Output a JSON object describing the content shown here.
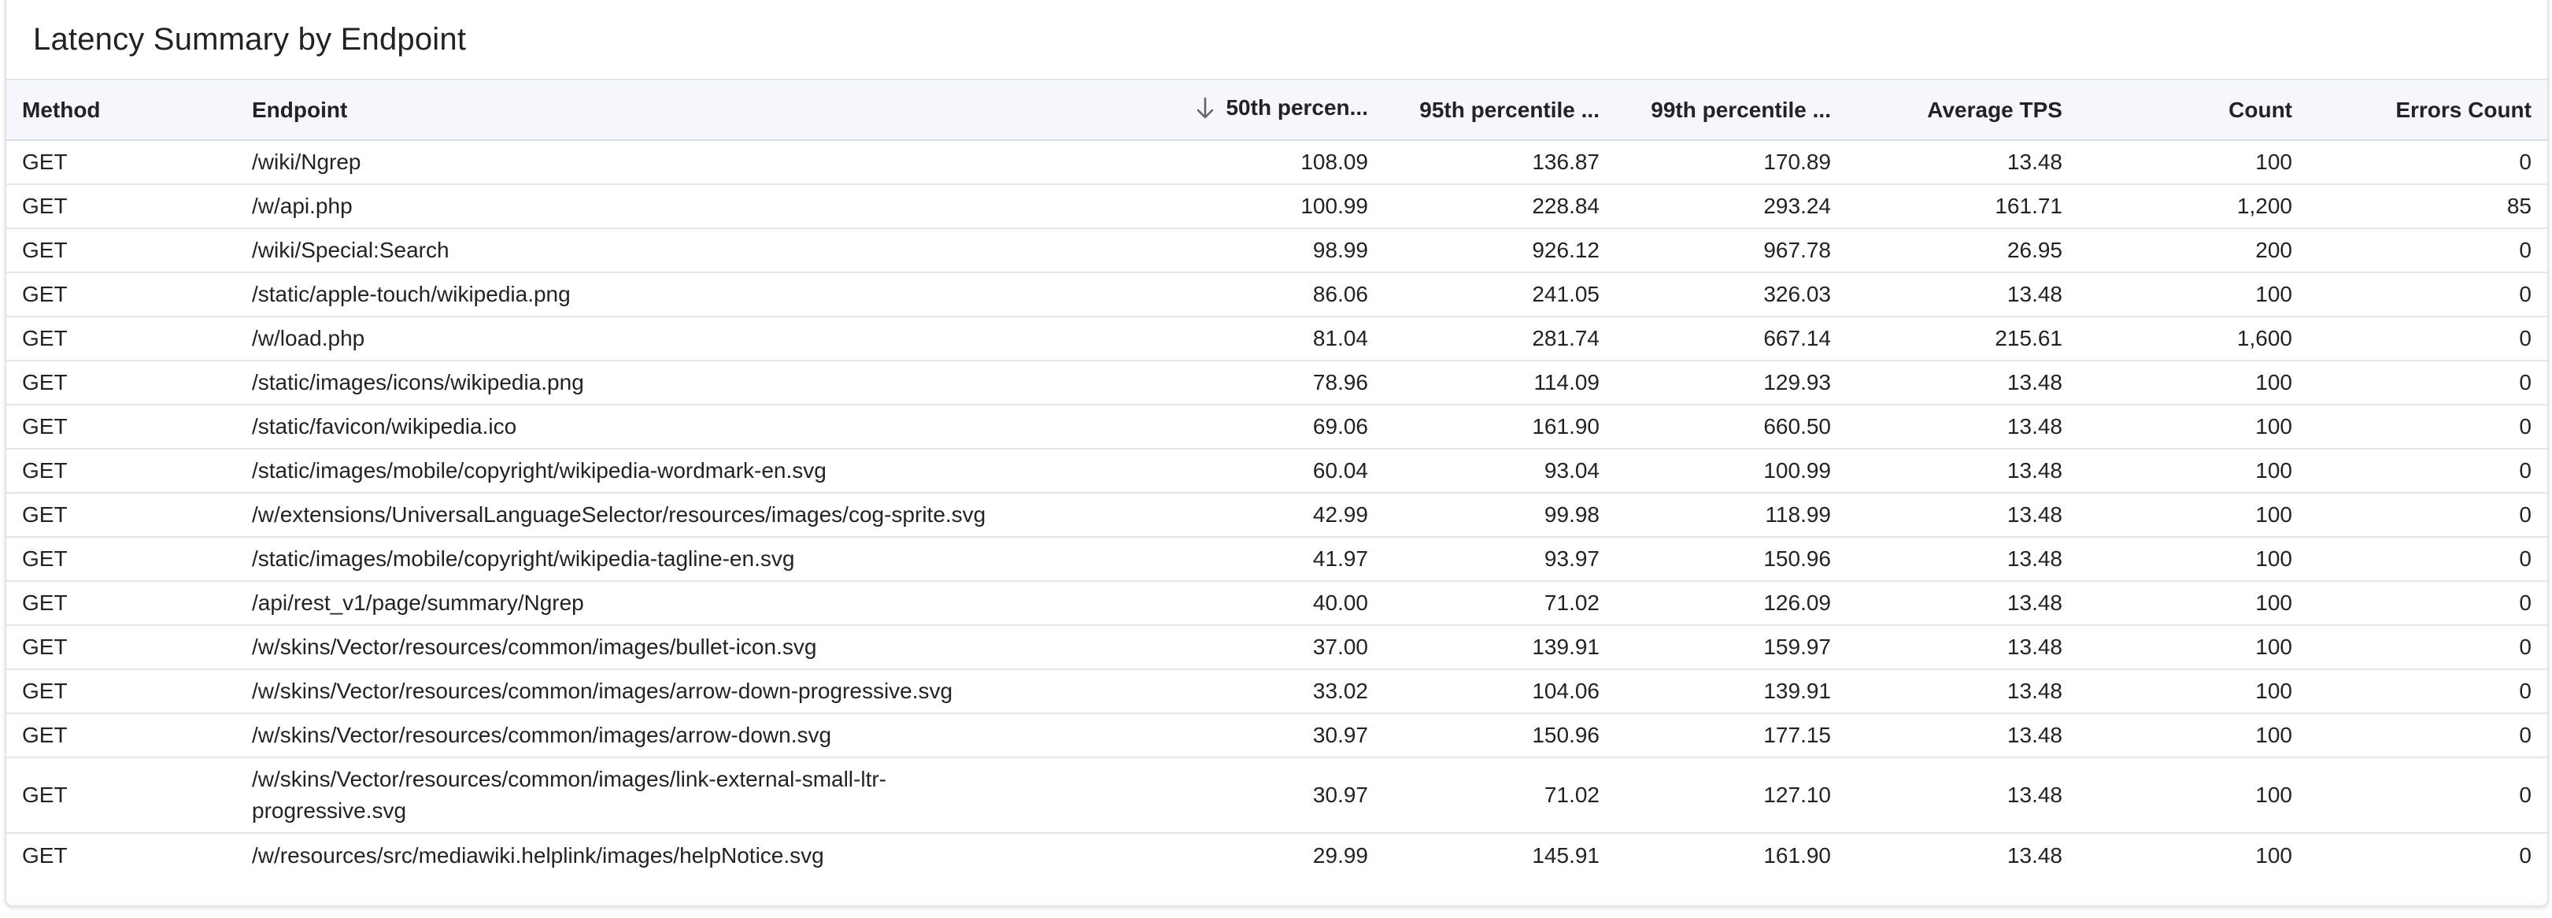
{
  "panel": {
    "title": "Latency Summary by Endpoint"
  },
  "table": {
    "columns": {
      "method": "Method",
      "endpoint": "Endpoint",
      "p50": "50th percen...",
      "p95": "95th percentile ...",
      "p99": "99th percentile ...",
      "avg_tps": "Average TPS",
      "count": "Count",
      "errors": "Errors Count"
    },
    "sort": {
      "column": "p50",
      "direction": "descending",
      "icon": "arrow-down-icon"
    },
    "rows": [
      {
        "method": "GET",
        "endpoint": "/wiki/Ngrep",
        "p50": "108.09",
        "p95": "136.87",
        "p99": "170.89",
        "avg_tps": "13.48",
        "count": "100",
        "errors": "0"
      },
      {
        "method": "GET",
        "endpoint": "/w/api.php",
        "p50": "100.99",
        "p95": "228.84",
        "p99": "293.24",
        "avg_tps": "161.71",
        "count": "1,200",
        "errors": "85"
      },
      {
        "method": "GET",
        "endpoint": "/wiki/Special:Search",
        "p50": "98.99",
        "p95": "926.12",
        "p99": "967.78",
        "avg_tps": "26.95",
        "count": "200",
        "errors": "0"
      },
      {
        "method": "GET",
        "endpoint": "/static/apple-touch/wikipedia.png",
        "p50": "86.06",
        "p95": "241.05",
        "p99": "326.03",
        "avg_tps": "13.48",
        "count": "100",
        "errors": "0"
      },
      {
        "method": "GET",
        "endpoint": "/w/load.php",
        "p50": "81.04",
        "p95": "281.74",
        "p99": "667.14",
        "avg_tps": "215.61",
        "count": "1,600",
        "errors": "0"
      },
      {
        "method": "GET",
        "endpoint": "/static/images/icons/wikipedia.png",
        "p50": "78.96",
        "p95": "114.09",
        "p99": "129.93",
        "avg_tps": "13.48",
        "count": "100",
        "errors": "0"
      },
      {
        "method": "GET",
        "endpoint": "/static/favicon/wikipedia.ico",
        "p50": "69.06",
        "p95": "161.90",
        "p99": "660.50",
        "avg_tps": "13.48",
        "count": "100",
        "errors": "0"
      },
      {
        "method": "GET",
        "endpoint": "/static/images/mobile/copyright/wikipedia-wordmark-en.svg",
        "p50": "60.04",
        "p95": "93.04",
        "p99": "100.99",
        "avg_tps": "13.48",
        "count": "100",
        "errors": "0"
      },
      {
        "method": "GET",
        "endpoint": "/w/extensions/UniversalLanguageSelector/resources/images/cog-sprite.svg",
        "p50": "42.99",
        "p95": "99.98",
        "p99": "118.99",
        "avg_tps": "13.48",
        "count": "100",
        "errors": "0"
      },
      {
        "method": "GET",
        "endpoint": "/static/images/mobile/copyright/wikipedia-tagline-en.svg",
        "p50": "41.97",
        "p95": "93.97",
        "p99": "150.96",
        "avg_tps": "13.48",
        "count": "100",
        "errors": "0"
      },
      {
        "method": "GET",
        "endpoint": "/api/rest_v1/page/summary/Ngrep",
        "p50": "40.00",
        "p95": "71.02",
        "p99": "126.09",
        "avg_tps": "13.48",
        "count": "100",
        "errors": "0"
      },
      {
        "method": "GET",
        "endpoint": "/w/skins/Vector/resources/common/images/bullet-icon.svg",
        "p50": "37.00",
        "p95": "139.91",
        "p99": "159.97",
        "avg_tps": "13.48",
        "count": "100",
        "errors": "0"
      },
      {
        "method": "GET",
        "endpoint": "/w/skins/Vector/resources/common/images/arrow-down-progressive.svg",
        "p50": "33.02",
        "p95": "104.06",
        "p99": "139.91",
        "avg_tps": "13.48",
        "count": "100",
        "errors": "0"
      },
      {
        "method": "GET",
        "endpoint": "/w/skins/Vector/resources/common/images/arrow-down.svg",
        "p50": "30.97",
        "p95": "150.96",
        "p99": "177.15",
        "avg_tps": "13.48",
        "count": "100",
        "errors": "0"
      },
      {
        "method": "GET",
        "endpoint": "/w/skins/Vector/resources/common/images/link-external-small-ltr-progressive.svg",
        "p50": "30.97",
        "p95": "71.02",
        "p99": "127.10",
        "avg_tps": "13.48",
        "count": "100",
        "errors": "0"
      },
      {
        "method": "GET",
        "endpoint": "/w/resources/src/mediawiki.helplink/images/helpNotice.svg",
        "p50": "29.99",
        "p95": "145.91",
        "p99": "161.90",
        "avg_tps": "13.48",
        "count": "100",
        "errors": "0"
      }
    ]
  }
}
